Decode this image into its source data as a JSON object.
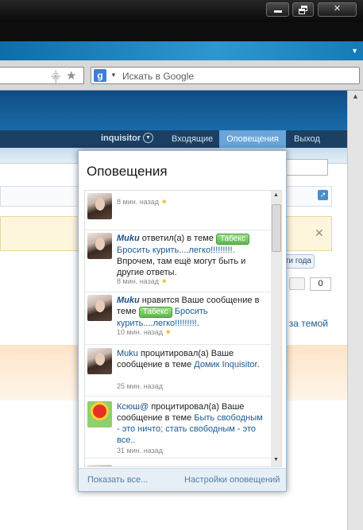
{
  "browser": {
    "search_placeholder": "Искать в Google",
    "search_engine_letter": "g"
  },
  "nav": {
    "username": "inquisitor",
    "inbox": "Входящие",
    "alerts": "Оповещения",
    "logout": "Выход"
  },
  "page": {
    "go_button": "ти года",
    "counter": "0",
    "follow_link": "ить за темой"
  },
  "popup": {
    "title": "Оповещения",
    "items": [
      {
        "time": "8 мин. назад"
      },
      {
        "user": "Muku",
        "action": " ответил(а) в теме ",
        "tag": "Табекс",
        "thread": "Бросить курить....легко!!!!!!!!!.",
        "extra": " Впрочем, там ещё могут быть и другие ответы.",
        "time": "8 мин. назад"
      },
      {
        "user": "Muku",
        "action": " нравится Ваше сообщение в теме ",
        "tag": "Табекс",
        "thread": "Бросить курить....легко!!!!!!!!!",
        "extra": ".",
        "time": "10 мин. назад"
      },
      {
        "user": "Muku",
        "action": " процитировал(а) Ваше сообщение в теме ",
        "thread": "Домик Inquisitor",
        "extra": ".",
        "time": "25 мин. назад"
      },
      {
        "user": "Ксюш@",
        "action": " процитировал(а) Ваше сообщение в теме ",
        "thread": "Быть свободным - это ничто; стать свободным - это все..",
        "extra": "",
        "time": "31 мин. назад"
      }
    ],
    "show_all": "Показать все...",
    "settings": "Настройки оповещений"
  }
}
